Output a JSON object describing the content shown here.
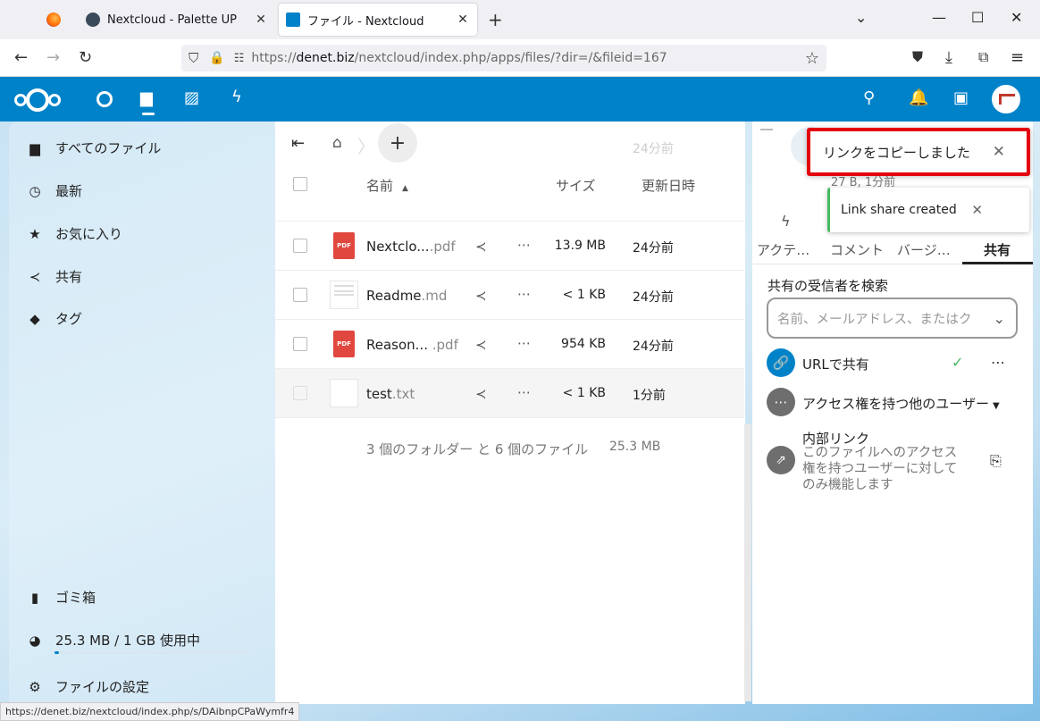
{
  "browser": {
    "tabs": [
      {
        "title": "Nextcloud - Palette UP",
        "active": false
      },
      {
        "title": "ファイル - Nextcloud",
        "active": true
      }
    ],
    "url_prefix": "https://",
    "url_host": "denet.biz",
    "url_path": "/nextcloud/index.php/apps/files/?dir=/&fileid=167",
    "status_url": "https://denet.biz/nextcloud/index.php/s/DAibnpCPaWymfr4"
  },
  "sidebar": {
    "items": [
      {
        "label": "すべてのファイル",
        "icon": "folder-icon"
      },
      {
        "label": "最新",
        "icon": "clock-icon"
      },
      {
        "label": "お気に入り",
        "icon": "star-icon"
      },
      {
        "label": "共有",
        "icon": "share-icon"
      },
      {
        "label": "タグ",
        "icon": "tag-icon"
      }
    ],
    "trash_label": "ゴミ箱",
    "quota_label": "25.3 MB / 1 GB 使用中",
    "quota_fraction": 0.025,
    "settings_label": "ファイルの設定"
  },
  "files": {
    "header": {
      "name": "名前",
      "size": "サイズ",
      "modified": "更新日時"
    },
    "faded_date": "24分前",
    "rows": [
      {
        "name": "Nextclo...",
        "ext": ".pdf",
        "size": "13.9 MB",
        "date": "24分前",
        "type": "pdf"
      },
      {
        "name": "Readme",
        "ext": ".md",
        "size": "< 1 KB",
        "date": "24分前",
        "type": "doc"
      },
      {
        "name": "Reason...",
        "ext": " .pdf",
        "size": "954 KB",
        "date": "24分前",
        "type": "pdf"
      },
      {
        "name": "test",
        "ext": ".txt",
        "size": "< 1 KB",
        "date": "1分前",
        "type": "doc"
      }
    ],
    "summary": "3 個のフォルダー と 6 個のファイル",
    "summary_size": "25.3 MB"
  },
  "sidebar_right": {
    "meta": "27 B, 1分前",
    "tabs": [
      "アクテ…",
      "コメント",
      "バージ…",
      "共有"
    ],
    "active_tab": "共有",
    "search_label": "共有の受信者を検索",
    "search_placeholder": "名前、メールアドレス、またはク",
    "url_share_label": "URLで共有",
    "others_label": "アクセス権を持つ他のユーザー",
    "internal_title": "内部リンク",
    "internal_desc_1": "このファイルへのアクセス",
    "internal_desc_2": "権を持つユーザーに対して",
    "internal_desc_3": "のみ機能します"
  },
  "toasts": {
    "copied": "リンクをコピーしました",
    "created": "Link share created"
  },
  "colors": {
    "brand": "#0082c9",
    "highlight": "#e3000f",
    "success": "#46ba61"
  }
}
